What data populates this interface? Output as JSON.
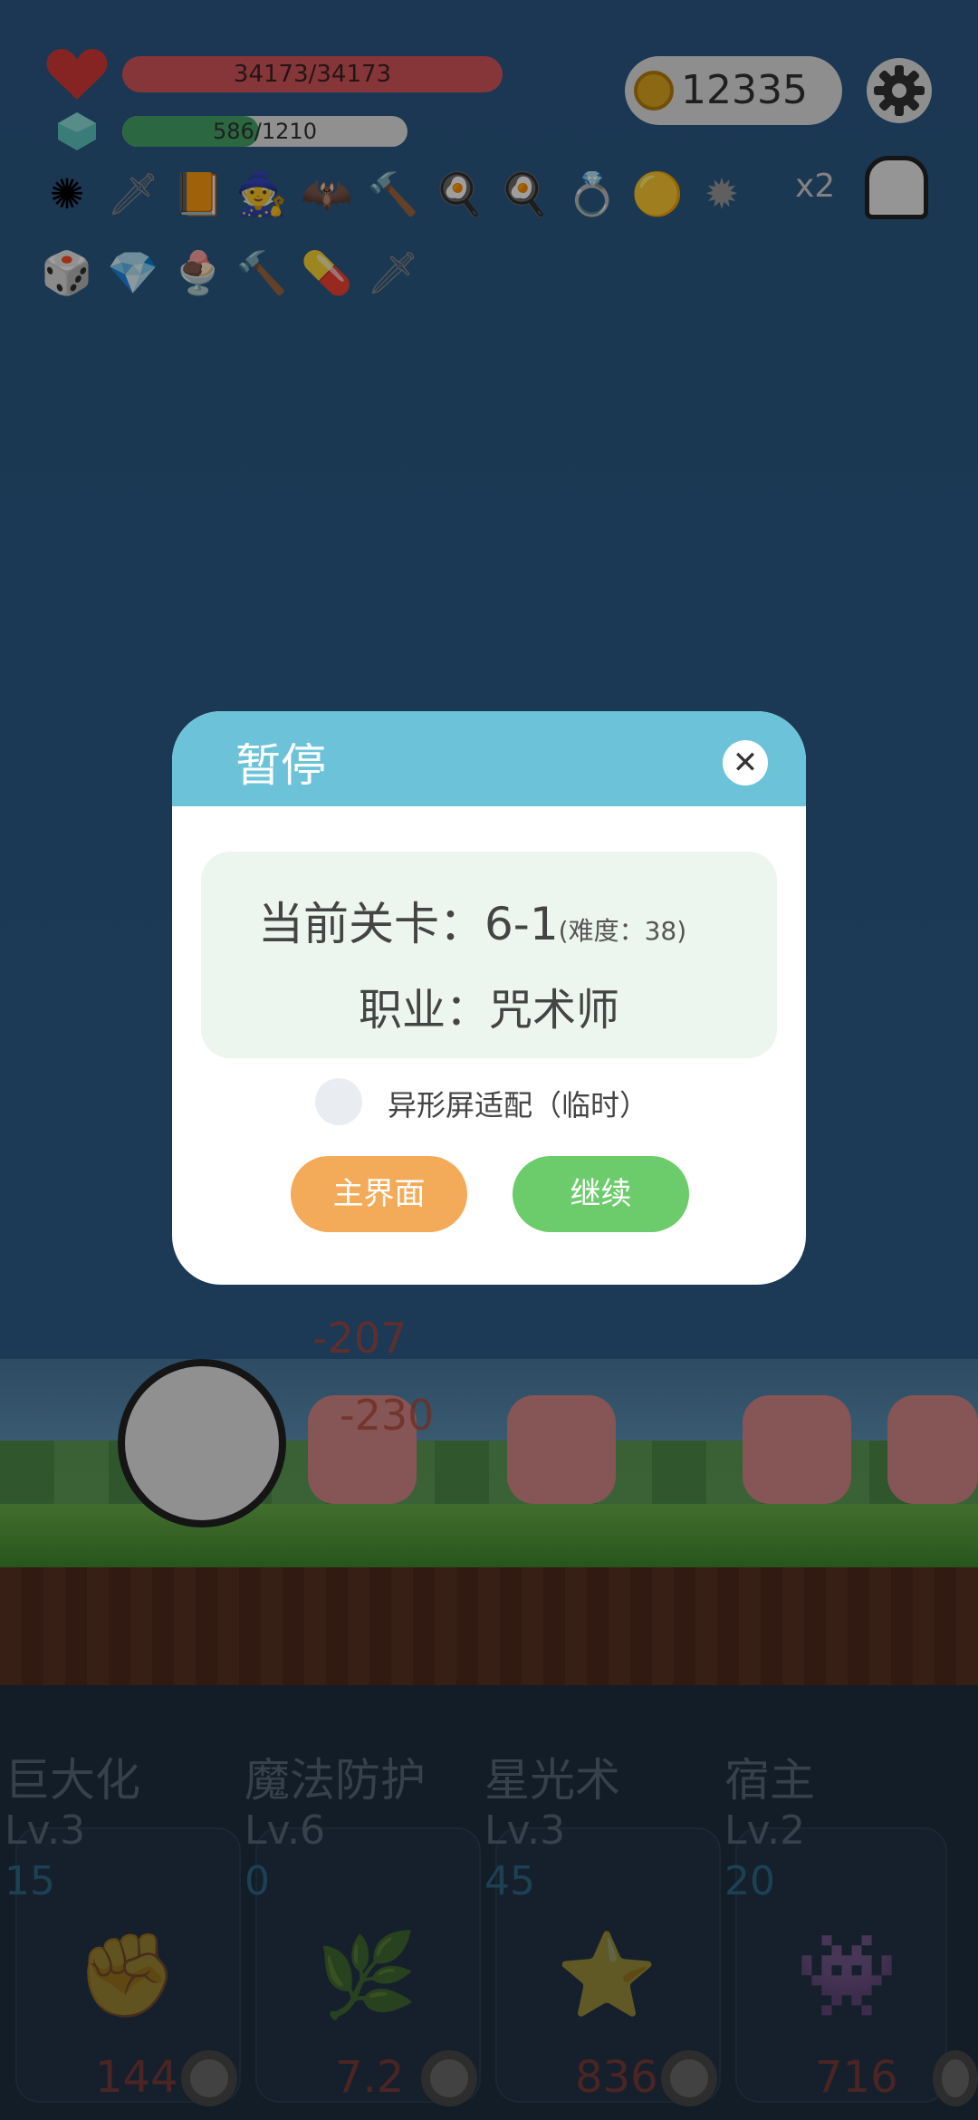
{
  "hud": {
    "hp_text": "34173/34173",
    "xp_text": "586/1210",
    "xp_fraction": 0.48,
    "coins": "12335",
    "speed": "x2"
  },
  "inventory_icons": [
    "spiked-mace-icon",
    "sword-icon",
    "spellbook-icon",
    "wizard-hat-icon",
    "bat-icon",
    "hammer-icon",
    "fried-egg-icon",
    "fried-egg-icon",
    "ring-icon",
    "orb-icon",
    "spiked-ball-icon",
    "dice-icon",
    "diamond-icon",
    "ice-cream-icon",
    "hammer-icon",
    "capsule-icon",
    "sword-icon"
  ],
  "dialog": {
    "title": "暂停",
    "level_label": "当前关卡：6-1",
    "difficulty": "(难度：38)",
    "job": "职业：咒术师",
    "notch_option": "异形屏适配（临时）",
    "main_menu": "主界面",
    "continue": "继续"
  },
  "battle": {
    "damage_1": "-207",
    "damage_2": "-230"
  },
  "skills": [
    {
      "name": "巨大化",
      "level": "Lv.3",
      "cost": "15",
      "value": "144",
      "icon": "fist-icon"
    },
    {
      "name": "魔法防护",
      "level": "Lv.6",
      "cost": "0",
      "value": "7.2",
      "icon": "leaf-icon"
    },
    {
      "name": "星光术",
      "level": "Lv.3",
      "cost": "45",
      "value": "836",
      "icon": "star-wand-icon"
    },
    {
      "name": "宿主",
      "level": "Lv.2",
      "cost": "20",
      "value": "716",
      "icon": "monster-icon"
    }
  ]
}
